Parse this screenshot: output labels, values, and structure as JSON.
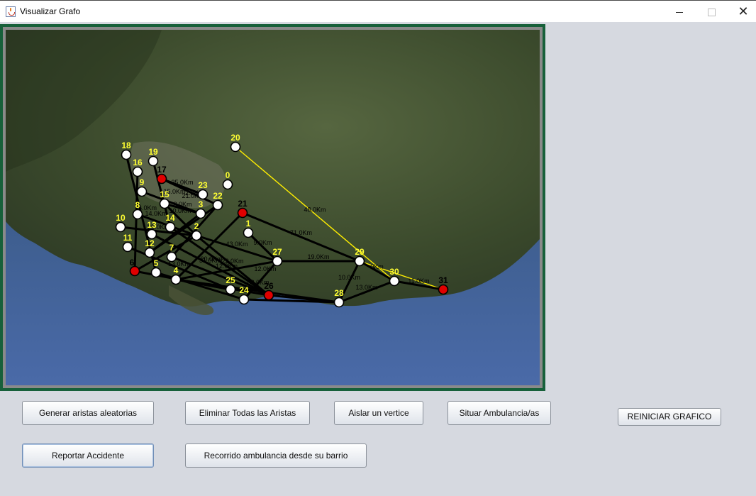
{
  "window": {
    "title": "Visualizar Grafo",
    "icon": "java-cup-icon",
    "controls": {
      "minimize": "minimize-icon",
      "maximize": "maximize-icon",
      "close": "✕"
    }
  },
  "graph": {
    "colors": {
      "background_land": "#3d4a2e",
      "sea": "#3a5a86",
      "normal_vertex": "#ffffff",
      "accident_vertex": "#e00000",
      "label": "#ffff33",
      "dark_label": "#000000",
      "edge": "#000000",
      "route_edge": "#ffee00",
      "frame": "#17603a"
    },
    "vertices": [
      {
        "id": "0",
        "red": false
      },
      {
        "id": "1",
        "red": false
      },
      {
        "id": "2",
        "red": false
      },
      {
        "id": "3",
        "red": false
      },
      {
        "id": "4",
        "red": false
      },
      {
        "id": "5",
        "red": false
      },
      {
        "id": "6",
        "red": true
      },
      {
        "id": "7",
        "red": false
      },
      {
        "id": "8",
        "red": false
      },
      {
        "id": "9",
        "red": false
      },
      {
        "id": "10",
        "red": false
      },
      {
        "id": "11",
        "red": false
      },
      {
        "id": "12",
        "red": false
      },
      {
        "id": "13",
        "red": false
      },
      {
        "id": "14",
        "red": false
      },
      {
        "id": "15",
        "red": false
      },
      {
        "id": "16",
        "red": false
      },
      {
        "id": "17",
        "red": true
      },
      {
        "id": "18",
        "red": false
      },
      {
        "id": "19",
        "red": false
      },
      {
        "id": "20",
        "red": false
      },
      {
        "id": "21",
        "red": true
      },
      {
        "id": "22",
        "red": false
      },
      {
        "id": "23",
        "red": false
      },
      {
        "id": "24",
        "red": false
      },
      {
        "id": "25",
        "red": false
      },
      {
        "id": "26",
        "red": true
      },
      {
        "id": "27",
        "red": false
      },
      {
        "id": "28",
        "red": false
      },
      {
        "id": "29",
        "red": false
      },
      {
        "id": "30",
        "red": false
      },
      {
        "id": "31",
        "red": true
      }
    ],
    "edges": [
      {
        "a": "20",
        "b": "30",
        "w": "48.0Km",
        "route": true
      },
      {
        "a": "29",
        "b": "31",
        "w": "",
        "route": true
      },
      {
        "a": "30",
        "b": "31",
        "w": "",
        "route": true
      },
      {
        "a": "21",
        "b": "29",
        "w": "71.0Km",
        "route": false
      },
      {
        "a": "27",
        "b": "29",
        "w": "19.0Km",
        "route": false
      },
      {
        "a": "29",
        "b": "30",
        "w": "0Km",
        "route": false
      },
      {
        "a": "29",
        "b": "28",
        "w": "10.0Km",
        "route": false
      },
      {
        "a": "28",
        "b": "30",
        "w": "13.0Km",
        "route": false
      },
      {
        "a": "30",
        "b": "31",
        "w": "11.0Km",
        "route": false
      },
      {
        "a": "1",
        "b": "27",
        "w": "9.0Km",
        "route": false
      },
      {
        "a": "21",
        "b": "4",
        "w": "",
        "route": false
      },
      {
        "a": "2",
        "b": "27",
        "w": "43.0Km",
        "route": false
      },
      {
        "a": "27",
        "b": "24",
        "w": "",
        "route": false
      },
      {
        "a": "26",
        "b": "28",
        "w": "",
        "route": false
      },
      {
        "a": "24",
        "b": "28",
        "w": "",
        "route": false
      },
      {
        "a": "22",
        "b": "7",
        "w": "",
        "route": false
      },
      {
        "a": "14",
        "b": "26",
        "w": "",
        "route": false
      },
      {
        "a": "13",
        "b": "26",
        "w": "31.0Km",
        "route": false
      },
      {
        "a": "6",
        "b": "25",
        "w": "",
        "route": false
      },
      {
        "a": "4",
        "b": "25",
        "w": "",
        "route": false
      },
      {
        "a": "5",
        "b": "24",
        "w": "",
        "route": false
      },
      {
        "a": "4",
        "b": "26",
        "w": "",
        "route": false
      },
      {
        "a": "4",
        "b": "28",
        "w": "",
        "route": false
      },
      {
        "a": "10",
        "b": "2",
        "w": "20.0Km",
        "route": false
      },
      {
        "a": "2",
        "b": "26",
        "w": "22.0Km",
        "route": false
      },
      {
        "a": "15",
        "b": "2",
        "w": "",
        "route": false
      },
      {
        "a": "15",
        "b": "3",
        "w": "8.0Km",
        "route": false
      },
      {
        "a": "17",
        "b": "23",
        "w": "35.0Km",
        "route": false
      },
      {
        "a": "17",
        "b": "22",
        "w": "",
        "route": false
      },
      {
        "a": "18",
        "b": "5",
        "w": "",
        "route": false
      },
      {
        "a": "16",
        "b": "6",
        "w": "",
        "route": false
      },
      {
        "a": "19",
        "b": "14",
        "w": "",
        "route": false
      },
      {
        "a": "9",
        "b": "3",
        "w": "",
        "route": false
      },
      {
        "a": "8",
        "b": "2",
        "w": "",
        "route": false
      },
      {
        "a": "11",
        "b": "25",
        "w": "13.0Km",
        "route": false
      },
      {
        "a": "12",
        "b": "22",
        "w": "",
        "route": false
      },
      {
        "a": "12",
        "b": "3",
        "w": "",
        "route": false
      },
      {
        "a": "7",
        "b": "26",
        "w": "",
        "route": false
      },
      {
        "a": "4",
        "b": "27",
        "w": "12.0Km",
        "route": false
      },
      {
        "a": "6",
        "b": "2",
        "w": "",
        "route": false
      }
    ],
    "extra_labels": [
      "15.0Km",
      "21.0Km",
      "10.0Km",
      "14.0Km",
      "2.0Km",
      "12.0Km",
      "6.0Km",
      "20.0Km",
      "88.0Km"
    ]
  },
  "buttons": {
    "generar": "Generar aristas aleatorias",
    "eliminar": "Eliminar Todas las Aristas",
    "aislar": "Aislar un vertice",
    "situar": "Situar Ambulancia/as",
    "reiniciar": "REINICIAR GRAFICO",
    "reportar": "Reportar Accidente",
    "recorrido": "Recorrido ambulancia desde su barrio"
  }
}
